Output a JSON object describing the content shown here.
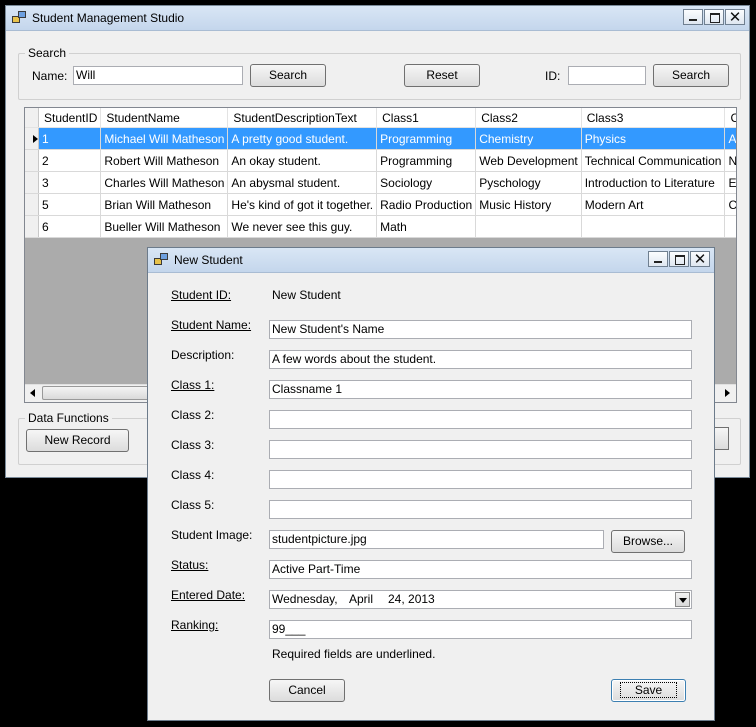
{
  "main_window": {
    "title": "Student Management Studio",
    "search_group": {
      "legend": "Search",
      "name_label": "Name:",
      "name_value": "Will",
      "search_button": "Search",
      "reset_button": "Reset",
      "id_label": "ID:",
      "id_value": "",
      "id_search_button": "Search"
    },
    "grid": {
      "columns": [
        "StudentID",
        "StudentName",
        "StudentDescriptionText",
        "Class1",
        "Class2",
        "Class3",
        "Class"
      ],
      "rows": [
        [
          "1",
          "Michael Will Matheson",
          "A pretty good student.",
          "Programming",
          "Chemistry",
          "Physics",
          "Astro"
        ],
        [
          "2",
          "Robert Will Matheson",
          "An okay student.",
          "Programming",
          "Web Development",
          "Technical Communication",
          "Netw"
        ],
        [
          "3",
          "Charles Will Matheson",
          "An abysmal student.",
          "Sociology",
          "Pyschology",
          "Introduction to Literature",
          "Englis"
        ],
        [
          "5",
          "Brian Will Matheson",
          "He's kind of got it together.",
          "Radio Production",
          "Music History",
          "Modern Art",
          "Conte"
        ],
        [
          "6",
          "Bueller Will Matheson",
          "We never see this guy.",
          "Math",
          "",
          "",
          ""
        ]
      ]
    },
    "data_functions": {
      "legend": "Data Functions",
      "new_record_button": "New Record"
    }
  },
  "dialog": {
    "title": "New Student",
    "student_id_label": "Student ID:",
    "student_id_value": "New Student",
    "student_name_label": "Student Name:",
    "student_name_value": "New Student's Name",
    "description_label": "Description:",
    "description_value": "A few words about the student.",
    "class1_label": "Class 1:",
    "class1_value": "Classname 1",
    "class2_label": "Class 2:",
    "class2_value": "",
    "class3_label": "Class 3:",
    "class3_value": "",
    "class4_label": "Class 4:",
    "class4_value": "",
    "class5_label": "Class 5:",
    "class5_value": "",
    "image_label": "Student Image:",
    "image_value": "studentpicture.jpg",
    "browse_button": "Browse...",
    "status_label": "Status:",
    "status_value": "Active Part-Time",
    "entered_date_label": "Entered Date:",
    "entered_date": {
      "weekday": "Wednesday,",
      "month": "April",
      "day_year": "24, 2013"
    },
    "ranking_label": "Ranking:",
    "ranking_value": "99___",
    "required_note": "Required fields are underlined.",
    "cancel_button": "Cancel",
    "save_button": "Save"
  },
  "colors": {
    "selection": "#3399ff",
    "titlebar": "#c4d6ec",
    "window_bg": "#f0f0f0"
  }
}
